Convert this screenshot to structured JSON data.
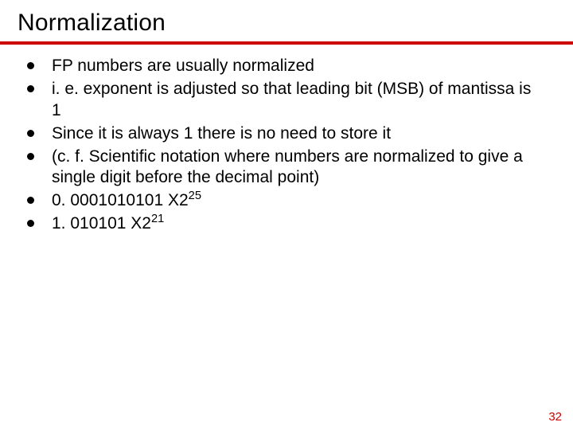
{
  "title": "Normalization",
  "bullets": [
    {
      "text": "FP numbers are usually normalized"
    },
    {
      "text": "i. e. exponent is adjusted so that leading bit (MSB) of mantissa is 1"
    },
    {
      "text": "Since it is always 1 there is no need to store it"
    },
    {
      "text": "(c. f. Scientific notation where numbers are normalized to give a single digit before the decimal point)"
    },
    {
      "base": "0. 0001010101 X2",
      "exp": "25"
    },
    {
      "base": "1. 010101 X2",
      "exp": "21"
    }
  ],
  "page_number": "32"
}
